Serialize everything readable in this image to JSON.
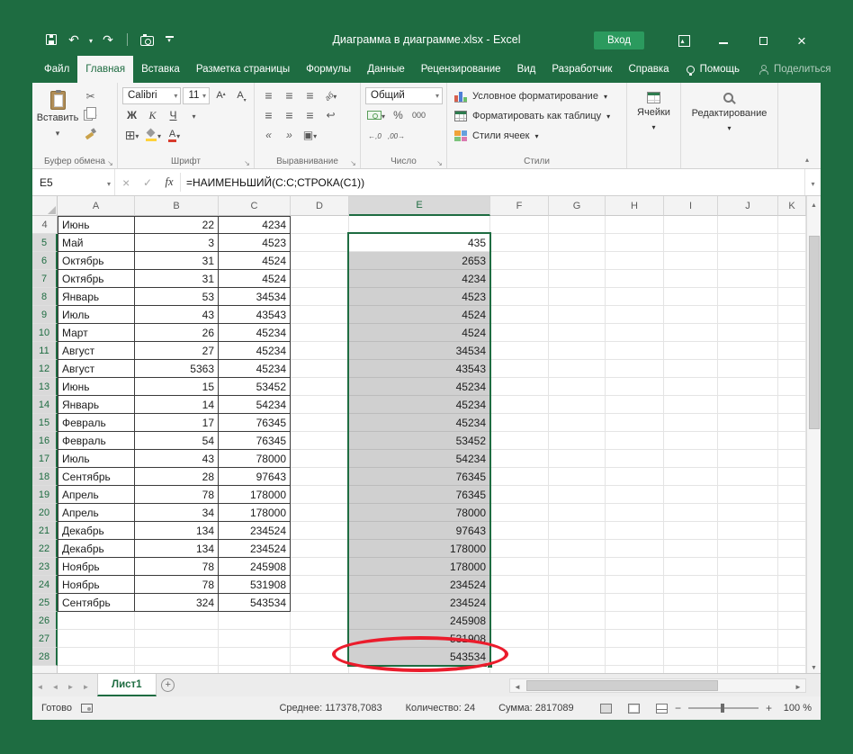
{
  "window": {
    "title": "Диаграмма в диаграмме.xlsx  -  Excel",
    "signin_label": "Вход"
  },
  "ribbon": {
    "tabs": [
      "Файл",
      "Главная",
      "Вставка",
      "Разметка страницы",
      "Формулы",
      "Данные",
      "Рецензирование",
      "Вид",
      "Разработчик",
      "Справка"
    ],
    "active_tab": "Главная",
    "help": "Помощь",
    "share": "Поделиться",
    "clipboard": {
      "group_label": "Буфер обмена",
      "paste_label": "Вставить"
    },
    "font": {
      "group_label": "Шрифт",
      "font_name": "Calibri",
      "font_size": "11",
      "bold": "Ж",
      "italic": "К",
      "underline": "Ч",
      "letter": "А"
    },
    "alignment": {
      "group_label": "Выравнивание"
    },
    "number": {
      "group_label": "Число",
      "format": "Общий",
      "percent": "%",
      "thousands": "000"
    },
    "styles": {
      "group_label": "Стили",
      "buttons": [
        "Условное форматирование",
        "Форматировать как таблицу",
        "Стили ячеек"
      ]
    },
    "cells": {
      "group_label": "Ячейки"
    },
    "editing": {
      "group_label": "Редактирование"
    }
  },
  "formula_bar": {
    "name_box": "E5",
    "fx": "fx",
    "formula": "=НАИМЕНЬШИЙ(C:C;СТРОКА(C1))"
  },
  "grid": {
    "columns": [
      "A",
      "B",
      "C",
      "D",
      "E",
      "F",
      "G",
      "H",
      "I",
      "J",
      "K"
    ],
    "selected_column": "E",
    "selection": {
      "active_cell": "E5",
      "column": "E",
      "first_row": 5,
      "last_row": 28
    },
    "bordered_region": {
      "first_row": 4,
      "last_row": 25,
      "columns": [
        "A",
        "B",
        "C"
      ]
    },
    "rows": [
      {
        "n": 4,
        "A": "Июнь",
        "B": "22",
        "C": "4234",
        "E": ""
      },
      {
        "n": 5,
        "A": "Май",
        "B": "3",
        "C": "4523",
        "E": "435"
      },
      {
        "n": 6,
        "A": "Октябрь",
        "B": "31",
        "C": "4524",
        "E": "2653"
      },
      {
        "n": 7,
        "A": "Октябрь",
        "B": "31",
        "C": "4524",
        "E": "4234"
      },
      {
        "n": 8,
        "A": "Январь",
        "B": "53",
        "C": "34534",
        "E": "4523"
      },
      {
        "n": 9,
        "A": "Июль",
        "B": "43",
        "C": "43543",
        "E": "4524"
      },
      {
        "n": 10,
        "A": "Март",
        "B": "26",
        "C": "45234",
        "E": "4524"
      },
      {
        "n": 11,
        "A": "Август",
        "B": "27",
        "C": "45234",
        "E": "34534"
      },
      {
        "n": 12,
        "A": "Август",
        "B": "5363",
        "C": "45234",
        "E": "43543"
      },
      {
        "n": 13,
        "A": "Июнь",
        "B": "15",
        "C": "53452",
        "E": "45234"
      },
      {
        "n": 14,
        "A": "Январь",
        "B": "14",
        "C": "54234",
        "E": "45234"
      },
      {
        "n": 15,
        "A": "Февраль",
        "B": "17",
        "C": "76345",
        "E": "45234"
      },
      {
        "n": 16,
        "A": "Февраль",
        "B": "54",
        "C": "76345",
        "E": "53452"
      },
      {
        "n": 17,
        "A": "Июль",
        "B": "43",
        "C": "78000",
        "E": "54234"
      },
      {
        "n": 18,
        "A": "Сентябрь",
        "B": "28",
        "C": "97643",
        "E": "76345"
      },
      {
        "n": 19,
        "A": "Апрель",
        "B": "78",
        "C": "178000",
        "E": "76345"
      },
      {
        "n": 20,
        "A": "Апрель",
        "B": "34",
        "C": "178000",
        "E": "78000"
      },
      {
        "n": 21,
        "A": "Декабрь",
        "B": "134",
        "C": "234524",
        "E": "97643"
      },
      {
        "n": 22,
        "A": "Декабрь",
        "B": "134",
        "C": "234524",
        "E": "178000"
      },
      {
        "n": 23,
        "A": "Ноябрь",
        "B": "78",
        "C": "245908",
        "E": "178000"
      },
      {
        "n": 24,
        "A": "Ноябрь",
        "B": "78",
        "C": "531908",
        "E": "234524"
      },
      {
        "n": 25,
        "A": "Сентябрь",
        "B": "324",
        "C": "543534",
        "E": "234524"
      },
      {
        "n": 26,
        "A": "",
        "B": "",
        "C": "",
        "E": "245908"
      },
      {
        "n": 27,
        "A": "",
        "B": "",
        "C": "",
        "E": "531908"
      },
      {
        "n": 28,
        "A": "",
        "B": "",
        "C": "",
        "E": "543534"
      }
    ]
  },
  "sheet_bar": {
    "tab": "Лист1"
  },
  "status_bar": {
    "mode": "Готово",
    "average": "Среднее: 117378,7083",
    "count": "Количество: 24",
    "sum": "Сумма: 2817089",
    "zoom_out": "−",
    "zoom_in": "+",
    "zoom": "100 %"
  },
  "icons": {
    "save": "floppy-disk",
    "undo": "↶",
    "redo": "↷",
    "camera": "camera",
    "cut": "✂",
    "copy": "two-pages",
    "format_painter": "brush",
    "borders": "⊞",
    "fill_color": "paint-bucket-yellow",
    "font_color": "А-red-bar",
    "magnifier": "magnifying-glass",
    "lightbulb": "bulb",
    "person": "silhouette",
    "new_sheet": "circled-plus",
    "select_all": "corner-triangle"
  },
  "colors": {
    "excel_green": "#1e6c41",
    "signin_green": "#2b9a5e",
    "selection_fill": "#d0d0d0",
    "annotation_red": "#eb1c2c"
  }
}
